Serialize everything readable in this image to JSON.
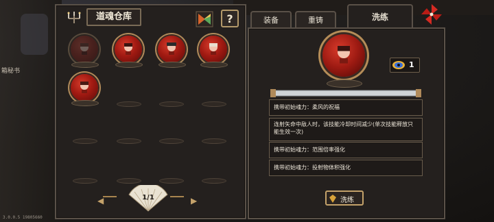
{
  "background": {
    "hint_text": "箱秘书",
    "version": "3.0.0.5 19805660"
  },
  "warehouse": {
    "title": "道魂仓库",
    "help_label": "?",
    "page": "1/1",
    "prev_arrow": "◀",
    "next_arrow": "▶",
    "souls": [
      {
        "state": "dim"
      },
      {
        "state": "active"
      },
      {
        "state": "active"
      },
      {
        "state": "active"
      },
      {
        "state": "active"
      }
    ]
  },
  "tabs": {
    "equip": "装备",
    "recast": "重铸",
    "refine": "洗练"
  },
  "detail": {
    "material_count": "1",
    "perks": [
      "携带初始魂力：柔风的祝福",
      "连射矢命中敌人时，该技能冷却时间减少(单次技能释放只能生效一次)",
      "携带初始魂力：范围倍率强化",
      "携带初始魂力：投射物体积强化"
    ],
    "refine_button": "洗练"
  },
  "colors": {
    "orb_red": "#a11a12",
    "frame_gold": "#b08a5a",
    "panel_bg": "#24201e"
  }
}
